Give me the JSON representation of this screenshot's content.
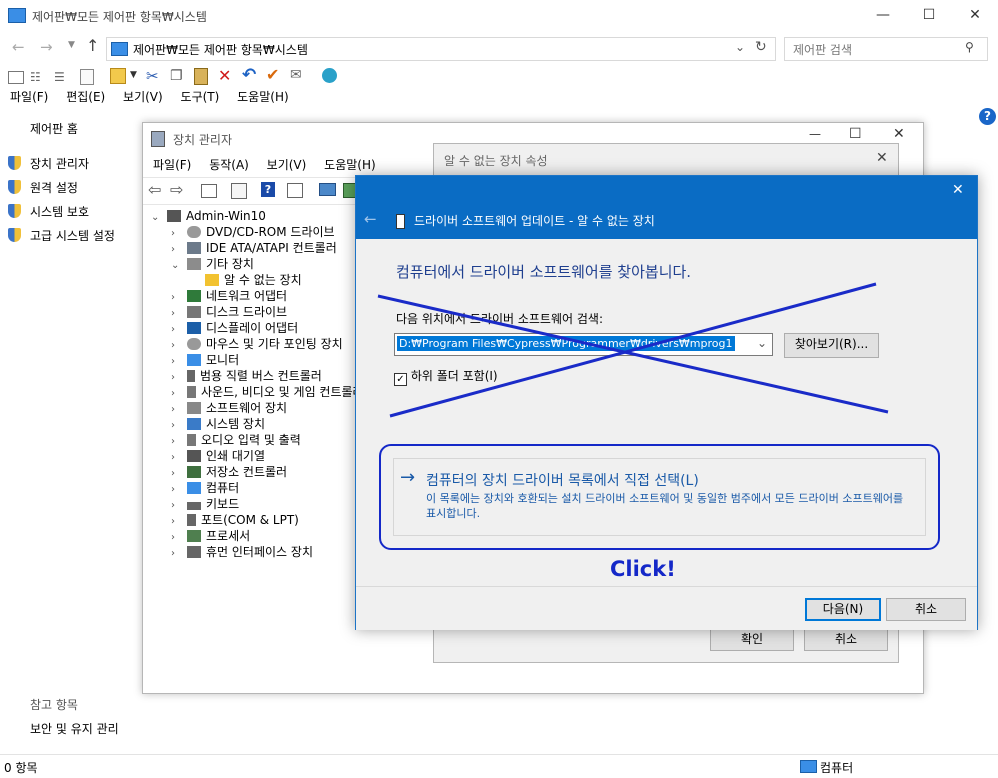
{
  "window": {
    "title": "제어판₩모든 제어판 항목₩시스템",
    "minimize": "—",
    "maximize": "☐",
    "close": "✕"
  },
  "address": {
    "path": "제어판₩모든 제어판 항목₩시스템",
    "search_placeholder": "제어판 검색"
  },
  "menu": [
    "파일(F)",
    "편집(E)",
    "보기(V)",
    "도구(T)",
    "도움말(H)"
  ],
  "left_nav": {
    "home": "제어판 홈",
    "items": [
      "장치 관리자",
      "원격 설정",
      "시스템 보호",
      "고급 시스템 설정"
    ],
    "see_also_title": "참고 항목",
    "see_also": [
      "보안 및 유지 관리"
    ]
  },
  "status": {
    "count": "0 항목",
    "computer": "컴퓨터"
  },
  "devmgr": {
    "title": "장치 관리자",
    "menu": [
      "파일(F)",
      "동작(A)",
      "보기(V)",
      "도움말(H)"
    ],
    "root": "Admin-Win10",
    "items": [
      {
        "label": "DVD/CD-ROM 드라이브",
        "expanded": false
      },
      {
        "label": "IDE ATA/ATAPI 컨트롤러",
        "expanded": false
      },
      {
        "label": "기타 장치",
        "expanded": true
      },
      {
        "label": "알 수 없는 장치",
        "child": true
      },
      {
        "label": "네트워크 어댑터",
        "expanded": false
      },
      {
        "label": "디스크 드라이브",
        "expanded": false
      },
      {
        "label": "디스플레이 어댑터",
        "expanded": false
      },
      {
        "label": "마우스 및 기타 포인팅 장치",
        "expanded": false
      },
      {
        "label": "모니터",
        "expanded": false
      },
      {
        "label": "범용 직렬 버스 컨트롤러",
        "expanded": false
      },
      {
        "label": "사운드, 비디오 및 게임 컨트롤러",
        "expanded": false
      },
      {
        "label": "소프트웨어 장치",
        "expanded": false
      },
      {
        "label": "시스템 장치",
        "expanded": false
      },
      {
        "label": "오디오 입력 및 출력",
        "expanded": false
      },
      {
        "label": "인쇄 대기열",
        "expanded": false
      },
      {
        "label": "저장소 컨트롤러",
        "expanded": false
      },
      {
        "label": "컴퓨터",
        "expanded": false
      },
      {
        "label": "키보드",
        "expanded": false
      },
      {
        "label": "포트(COM & LPT)",
        "expanded": false
      },
      {
        "label": "프로세서",
        "expanded": false
      },
      {
        "label": "휴먼 인터페이스 장치",
        "expanded": false
      }
    ]
  },
  "props": {
    "title": "알 수 없는 장치 속성",
    "ok": "확인",
    "cancel": "취소"
  },
  "wizard": {
    "close": "✕",
    "header": "드라이버 소프트웨어 업데이트 - 알 수 없는 장치",
    "heading": "컴퓨터에서 드라이버 소프트웨어를 찾아봅니다.",
    "search_label": "다음 위치에서 드라이버 소프트웨어 검색:",
    "path_value": "D:₩Program Files₩Cypress₩Programmer₩drivers₩mprog1",
    "browse": "찾아보기(R)...",
    "include_subfolders": "하위 폴더 포함(I)",
    "pick_title": "컴퓨터의 장치 드라이버 목록에서 직접 선택(L)",
    "pick_desc": "이 목록에는 장치와 호환되는 설치 드라이버 소프트웨어 및 동일한 범주에서 모든 드라이버 소프트웨어를 표시합니다.",
    "annotation": "Click!",
    "next": "다음(N)",
    "cancel": "취소"
  },
  "colors": {
    "accent": "#0a6cc4",
    "link": "#1a5aa8",
    "annotation": "#1428c8"
  }
}
